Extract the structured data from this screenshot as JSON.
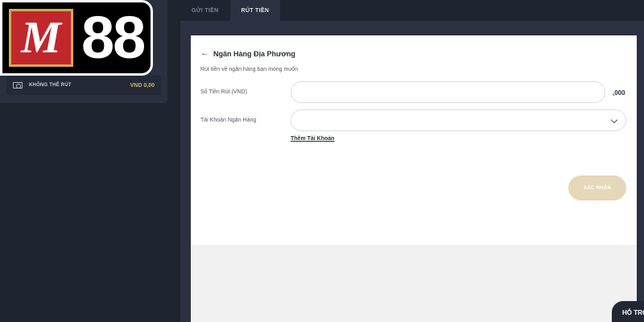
{
  "logo": {
    "letter": "M",
    "number": "88"
  },
  "account": {
    "label": "KHÔNG THỂ RÚT",
    "value": "VND 0,00"
  },
  "tabs": [
    {
      "label": "GỬI TIỀN",
      "active": false
    },
    {
      "label": "RÚT TIỀN",
      "active": true
    }
  ],
  "form": {
    "back_title": "Ngân Hàng Địa Phương",
    "subtitle": "Rút tiền về ngân hàng bạn mong muốn",
    "amount_label": "Số Tiền Rút (VND)",
    "amount_value": "",
    "amount_suffix": ",000",
    "bank_label": "Tài Khoản Ngân Hàng",
    "bank_value": "",
    "add_account": "Thêm Tài Khoản",
    "confirm": "XÁC NHẬN"
  },
  "support": {
    "label": "HỖ TRỢ"
  },
  "colors": {
    "accent": "#d2b370",
    "button_disabled": "#e6d7b8",
    "background": "#1e2430"
  }
}
